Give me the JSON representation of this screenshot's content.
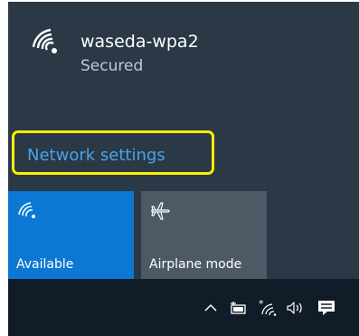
{
  "network": {
    "ssid": "waseda-wpa2",
    "status": "Secured",
    "icon": "wifi-signal-icon"
  },
  "network_settings": {
    "label": "Network settings",
    "highlight_color": "#ffee00",
    "link_color": "#49a3e8"
  },
  "quick_actions": [
    {
      "label": "Available",
      "icon": "wifi-icon",
      "active": true,
      "color": "#0c78d4"
    },
    {
      "label": "Airplane mode",
      "icon": "airplane-icon",
      "active": false,
      "color": "#4d5a66"
    }
  ],
  "taskbar": {
    "icons": [
      "chevron-up-icon",
      "battery-icon",
      "wifi-tray-icon",
      "volume-icon",
      "action-center-icon"
    ]
  },
  "colors": {
    "flyout_background": "#2b3846",
    "taskbar_background": "#101c27"
  }
}
